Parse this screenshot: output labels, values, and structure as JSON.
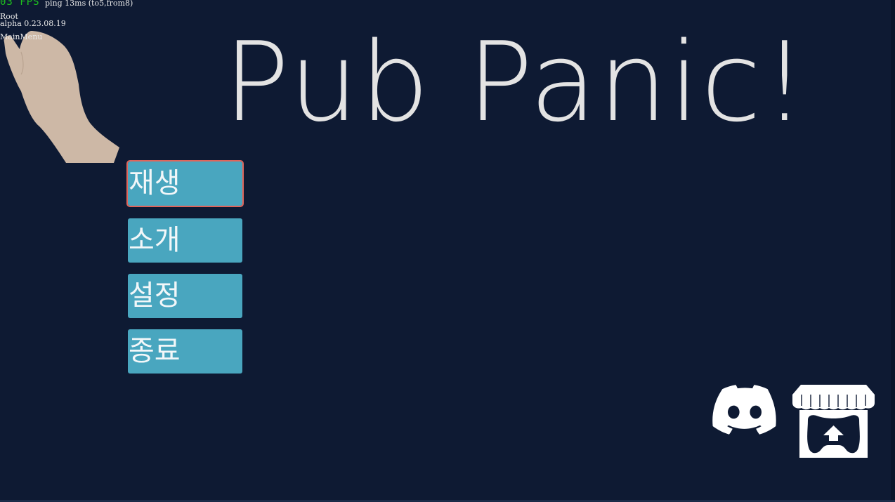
{
  "debug": {
    "fps": "03 FPS",
    "ping": "ping 13ms (to5,from8)",
    "root": "Root",
    "version": "alpha 0.23.08.19",
    "scene": "MainMenu"
  },
  "title": "Pub Panic!",
  "menu": {
    "selected_index": 0,
    "items": [
      {
        "label": "재생"
      },
      {
        "label": "소개"
      },
      {
        "label": "설정"
      },
      {
        "label": "종료"
      }
    ]
  },
  "social": {
    "discord_icon": "discord-icon",
    "itch_icon": "itch-io-icon"
  },
  "colors": {
    "background": "#0e1a33",
    "button": "#49a6bf",
    "selected_outline": "#e0645a",
    "title": "#e3e3e3",
    "fps": "#1ec21e",
    "hand": "#cdb8a6"
  }
}
